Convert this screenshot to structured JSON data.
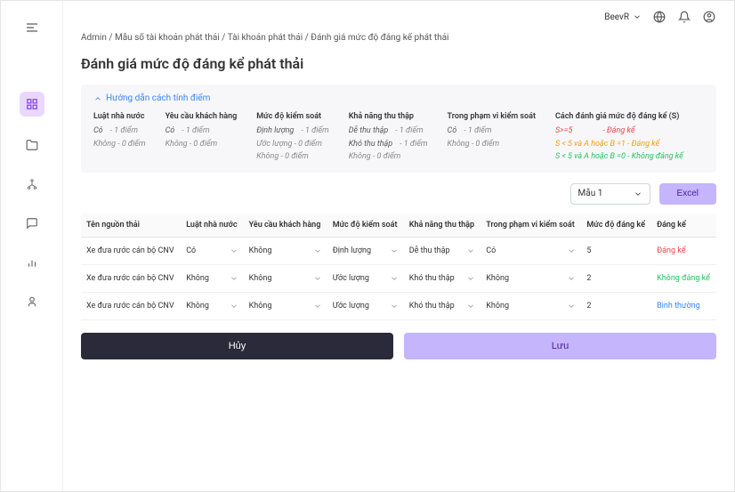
{
  "topbar": {
    "user": "BeevR"
  },
  "breadcrumb": {
    "items": [
      "Admin",
      "Mẫu sổ tài khoản phát thải",
      "Tài khoản phát thải",
      "Đánh giá mức độ đáng kể phát thải"
    ]
  },
  "page_title": "Đánh giá mức độ đáng kể phát thải",
  "guide": {
    "header": "Hướng dẫn cách tính điểm",
    "cols": {
      "c1": {
        "head": "Luật nhà nước",
        "r1a": "Có",
        "r1b": "- 1 điểm",
        "r2a": "Không - 0 điểm"
      },
      "c2": {
        "head": "Yêu cầu khách hàng",
        "r1a": "Có",
        "r1b": "- 1 điểm",
        "r2a": "Không - 0 điểm"
      },
      "c3": {
        "head": "Mức độ kiểm soát",
        "r1a": "Định lượng",
        "r1b": "- 1 điểm",
        "r2a": "Ước lượng - 0 điểm",
        "r3a": "Không - 0 điểm"
      },
      "c4": {
        "head": "Khả năng thu thập",
        "r1a": "Dễ thu thập",
        "r1b": "- 1 điểm",
        "r2a": "Khó thu thập",
        "r2b": "- 1 điểm",
        "r3a": "Không - 0 điểm"
      },
      "c5": {
        "head": "Trong phạm vi kiểm soát",
        "r1a": "Có",
        "r1b": "- 1 điểm",
        "r2a": "Không - 0 điểm"
      },
      "c6": {
        "head": "Cách đánh giá mức độ đáng kể (S)",
        "r1": "S>=5",
        "r1s": "- Đáng kể",
        "r2": "S < 5 và A hoặc B =1 - Đáng kể",
        "r3": "S < 5 và A hoặc B =0 - Không đáng kể"
      }
    }
  },
  "controls": {
    "select_value": "Mẫu 1",
    "excel": "Excel"
  },
  "table": {
    "headers": {
      "h1": "Tên nguồn thải",
      "h2": "Luật nhà nước",
      "h3": "Yêu cầu khách hàng",
      "h4": "Mức độ kiểm soát",
      "h5": "Khả năng thu thập",
      "h6": "Trong phạm vi kiểm soát",
      "h7": "Mức độ đáng kể",
      "h8": "Đáng kể"
    },
    "rows": [
      {
        "name": "Xe đưa rước cán bộ CNV",
        "law": "Có",
        "cust": "Không",
        "ctrl": "Định lượng",
        "collect": "Dễ thu thập",
        "scope": "Có",
        "score": "5",
        "status": "Đáng kể",
        "status_class": "status-red"
      },
      {
        "name": "Xe đưa rước cán bộ CNV",
        "law": "Không",
        "cust": "Không",
        "ctrl": "Ước lượng",
        "collect": "Khó thu thập",
        "scope": "Không",
        "score": "2",
        "status": "Không đáng kể",
        "status_class": "status-green"
      },
      {
        "name": "Xe đưa rước cán bộ CNV",
        "law": "Không",
        "cust": "Không",
        "ctrl": "Ước lượng",
        "collect": "Khó thu thập",
        "scope": "Không",
        "score": "2",
        "status": "Bình thường",
        "status_class": "status-blue"
      }
    ]
  },
  "footer": {
    "cancel": "Hủy",
    "save": "Lưu"
  }
}
